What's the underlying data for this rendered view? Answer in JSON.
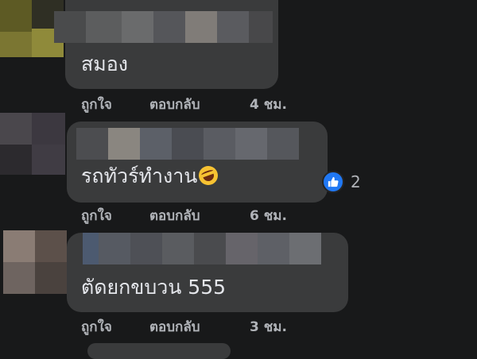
{
  "comments": [
    {
      "text": "สมอง",
      "actions": {
        "like": "ถูกใจ",
        "reply": "ตอบกลับ",
        "time": "4 ชม."
      }
    },
    {
      "text": "รถทัวร์ทำงาน",
      "emoji": "rolling-on-floor-laughing",
      "reaction": {
        "type": "like",
        "count": "2"
      },
      "actions": {
        "like": "ถูกใจ",
        "reply": "ตอบกลับ",
        "time": "6 ชม."
      }
    },
    {
      "text": "ตัดยกขบวน 555",
      "actions": {
        "like": "ถูกใจ",
        "reply": "ตอบกลับ",
        "time": "3 ชม."
      }
    }
  ],
  "colors": {
    "background": "#18191a",
    "bubble": "#3a3b3c",
    "text": "#e4e6eb",
    "secondary_text": "#b0b3b8",
    "like_blue": "#2078f4"
  }
}
